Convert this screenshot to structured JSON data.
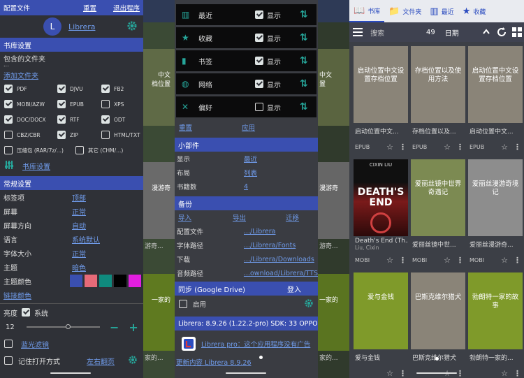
{
  "panel1": {
    "top": {
      "left": "配置文件",
      "reset": "重置",
      "exit": "退出程序"
    },
    "profile": {
      "avatar": "L",
      "name": "Librera"
    },
    "library_title": "书库设置",
    "include_folders": "包含的文件夹",
    "dots": "...",
    "add_folder": "添加文件夹",
    "formats": [
      {
        "label": "PDF",
        "checked": true
      },
      {
        "label": "DJVU",
        "checked": true
      },
      {
        "label": "FB2",
        "checked": true
      },
      {
        "label": "MOBI/AZW",
        "checked": true
      },
      {
        "label": "EPUB",
        "checked": true
      },
      {
        "label": "XPS",
        "checked": false
      },
      {
        "label": "DOC/DOCX",
        "checked": true
      },
      {
        "label": "RTF",
        "checked": true
      },
      {
        "label": "ODT",
        "checked": true
      },
      {
        "label": "CBZ/CBR",
        "checked": false
      },
      {
        "label": "ZIP",
        "checked": true
      },
      {
        "label": "HTML/TXT",
        "checked": false
      }
    ],
    "archive": {
      "label": "压缩包 (RAR/7z/...)",
      "checked": false
    },
    "other": {
      "label": "其它 (CHM/...)",
      "checked": false
    },
    "library_settings_link": "书库设置",
    "general_title": "常规设置",
    "general": [
      {
        "k": "标签项",
        "v": "顶部"
      },
      {
        "k": "屏幕",
        "v": "正常"
      },
      {
        "k": "屏幕方向",
        "v": "自动"
      },
      {
        "k": "语言",
        "v": "系统默认"
      },
      {
        "k": "字体大小",
        "v": "正常"
      },
      {
        "k": "主题",
        "v": "暗色"
      }
    ],
    "theme_color_label": "主题颜色",
    "swatches": [
      "#3a4fb0",
      "#e66a78",
      "#0f8a7e",
      "#000000",
      "#e21ee0"
    ],
    "link_color": "链接颜色",
    "brightness": {
      "label": "亮度",
      "system": "系统",
      "checked": true,
      "value": "12"
    },
    "blue_filter": {
      "label": "蓝光滤镜",
      "checked": false
    },
    "remember": {
      "label": "记住打开方式",
      "value": "左右翻页"
    }
  },
  "panel2": {
    "rows": [
      {
        "icon": "bookshelf-icon",
        "glyph": "▥",
        "label": "最近",
        "show": "显示",
        "checked": true
      },
      {
        "icon": "star-icon",
        "glyph": "★",
        "label": "收藏",
        "show": "显示",
        "checked": true
      },
      {
        "icon": "bookmark-icon",
        "glyph": "▮",
        "label": "书签",
        "show": "显示",
        "checked": true
      },
      {
        "icon": "globe-icon",
        "glyph": "◍",
        "label": "网络",
        "show": "显示",
        "checked": true
      },
      {
        "icon": "tools-icon",
        "glyph": "✕",
        "label": "偏好",
        "show": "显示",
        "checked": false
      }
    ],
    "reset": "重置",
    "apply": "应用",
    "widget_title": "小部件",
    "widget": [
      {
        "k": "显示",
        "v": "最近"
      },
      {
        "k": "布局",
        "v": "列表"
      },
      {
        "k": "书籍数",
        "v": "4"
      }
    ],
    "backup_title": "备份",
    "backup_actions": [
      "导入",
      "导出",
      "迁移"
    ],
    "paths": [
      {
        "k": "配置文件",
        "v": ".../Librera"
      },
      {
        "k": "字体路径",
        "v": ".../Librera/Fonts"
      },
      {
        "k": "下载",
        "v": ".../Librera/Downloads"
      },
      {
        "k": "音频路径",
        "v": "...ownload/Librera/TTS"
      }
    ],
    "sync_title": "同步 (Google Drive)",
    "sync_login": "登入",
    "sync_enable": "启用",
    "version": "Librera: 8.9.26 (1.22.2-pro) SDK: 33 OPPO",
    "pro_text": "Librera pro：这个应用程序没有广告",
    "changelog": "更新内容 Librera 8.9.26"
  },
  "panel3": {
    "tabs": [
      {
        "icon": "book-open-icon",
        "glyph": "📖",
        "label": "书库"
      },
      {
        "icon": "folder-icon",
        "glyph": "📁",
        "label": "文件夹"
      },
      {
        "icon": "bookshelf-icon",
        "glyph": "▥",
        "label": "最近"
      },
      {
        "icon": "star-icon",
        "glyph": "★",
        "label": "收藏"
      }
    ],
    "search_placeholder": "搜索",
    "count": "49",
    "sort": "日期",
    "books": [
      {
        "cover": "启动位置中文设置存档位置",
        "title": "启动位置中文...",
        "author": "",
        "format": "EPUB",
        "color": "#8a8478"
      },
      {
        "cover": "存档位置以及使用方法",
        "title": "存档位置以及...",
        "author": "",
        "format": "EPUB",
        "color": "#8a8478"
      },
      {
        "cover": "启动位置中文设置存档位置",
        "title": "启动位置中文...",
        "author": "",
        "format": "EPUB",
        "color": "#8a8478"
      },
      {
        "cover": "",
        "title": "Death's End (Th...",
        "author": "Liu, Cixin",
        "format": "MOBI",
        "color": "#6b1717",
        "special": true,
        "cover_top": "CIXIN LIU",
        "cover_big": "DEATH'S END"
      },
      {
        "cover": "爱丽丝镜中世界奇遇记",
        "title": "爱丽丝镜中世...",
        "author": "",
        "format": "MOBI",
        "color": "#7c8a52"
      },
      {
        "cover": "爱丽丝漫游奇境记",
        "title": "爱丽丝漫游奇...",
        "author": "",
        "format": "MOBI",
        "color": "#8d8d8d"
      },
      {
        "cover": "爱与金钱",
        "title": "爱与金钱",
        "author": "",
        "format": "",
        "color": "#7f9a2a"
      },
      {
        "cover": "巴斯克维尔猎犬",
        "title": "巴斯克维尔猎犬",
        "author": "",
        "format": "",
        "color": "#8a8478"
      },
      {
        "cover": "勃朗特一家的故事",
        "title": "勃朗特一家的...",
        "author": "",
        "format": "",
        "color": "#7f9a2a"
      }
    ]
  },
  "bg_strips": {
    "left": [
      "中文",
      "档位置",
      "漫游奇",
      "游奇...",
      "一家的",
      "家的..."
    ],
    "right": [
      "中文",
      "置",
      "漫游奇",
      "游奇...",
      "一家的",
      "家的..."
    ]
  }
}
